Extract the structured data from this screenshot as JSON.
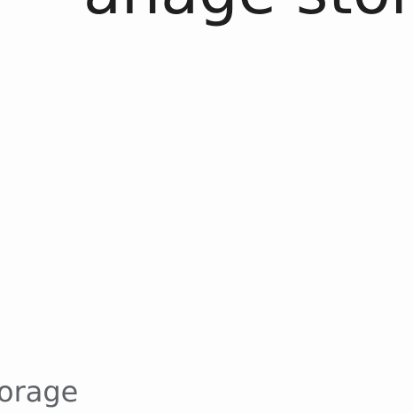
{
  "header": {
    "title": "anage storag"
  },
  "content": {
    "section_label": "orage"
  },
  "colors": {
    "background": "#fdfdfd",
    "title_text": "#1f1f1f",
    "label_text": "#5f6368"
  }
}
